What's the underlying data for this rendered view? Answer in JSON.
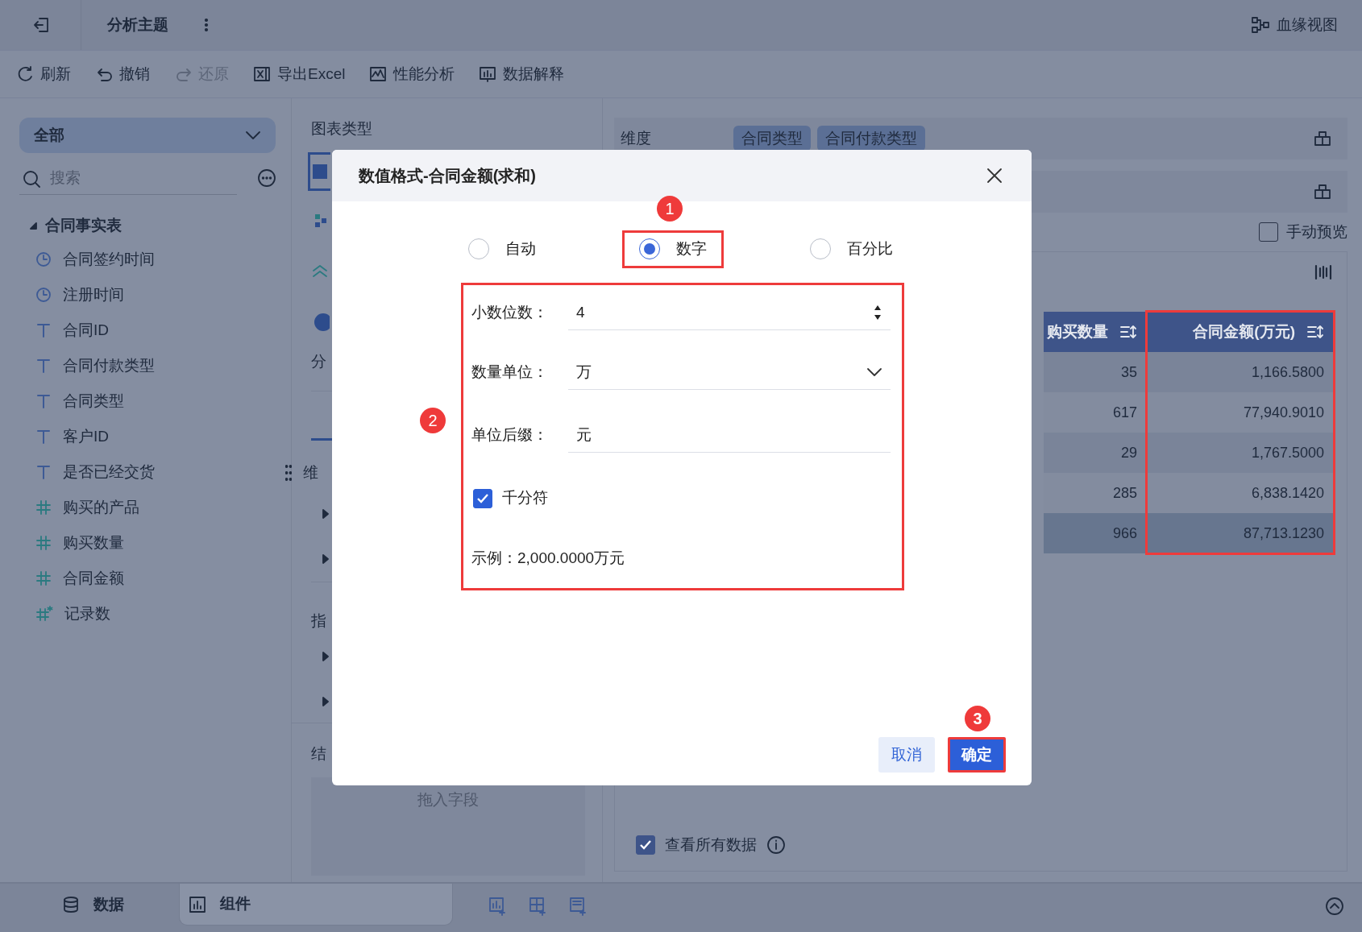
{
  "topbar": {
    "title": "分析主题",
    "lineage": "血缘视图"
  },
  "toolbar": [
    {
      "label": "刷新",
      "disabled": false
    },
    {
      "label": "撤销",
      "disabled": false
    },
    {
      "label": "还原",
      "disabled": true
    },
    {
      "label": "导出Excel",
      "disabled": false
    },
    {
      "label": "性能分析",
      "disabled": false
    },
    {
      "label": "数据解释",
      "disabled": false
    }
  ],
  "sidebar": {
    "scope": "全部",
    "search": {
      "placeholder": "搜索"
    },
    "table": {
      "label": "合同事实表",
      "expanded": true,
      "children": [
        {
          "kind": "date",
          "label": "合同签约时间"
        },
        {
          "kind": "date",
          "label": "注册时间"
        },
        {
          "kind": "text",
          "label": "合同ID"
        },
        {
          "kind": "text",
          "label": "合同付款类型"
        },
        {
          "kind": "text",
          "label": "合同类型"
        },
        {
          "kind": "text",
          "label": "客户ID"
        },
        {
          "kind": "text",
          "label": "是否已经交货"
        },
        {
          "kind": "number",
          "label": "购买的产品"
        },
        {
          "kind": "number",
          "label": "购买数量"
        },
        {
          "kind": "number",
          "label": "合同金额"
        },
        {
          "kind": "count",
          "label": "记录数"
        }
      ]
    }
  },
  "middle": {
    "heading": "图表类型",
    "chart_types": [
      {
        "selected": true
      },
      {
        "selected": false
      },
      {
        "selected": false
      },
      {
        "selected": false
      }
    ],
    "cut_labels": [
      "分",
      "维",
      "指",
      "结"
    ],
    "drop_hint": "拖入字段"
  },
  "right": {
    "dimension_label": "维度",
    "chips": [
      "合同类型",
      "合同付款类型"
    ],
    "manual_preview": {
      "label": "手动预览",
      "checked": false
    },
    "columns": [
      {
        "label": "购买数量",
        "highlighted": false,
        "cells": [
          "35",
          "617",
          "29",
          "285"
        ],
        "total": "966"
      },
      {
        "label": "合同金额(万元)",
        "highlighted": true,
        "cells": [
          "1,166.5800",
          "77,940.9010",
          "1,767.5000",
          "6,838.1420"
        ],
        "total": "87,713.1230"
      }
    ],
    "view_all": {
      "label": "查看所有数据",
      "checked": true
    }
  },
  "bottombar": {
    "tabs": [
      {
        "label": "数据",
        "selected": false
      },
      {
        "label": "组件",
        "selected": true
      }
    ]
  },
  "dialog": {
    "title": "数值格式-合同金额(求和)",
    "formats": [
      {
        "label": "自动",
        "selected": false,
        "highlighted": false
      },
      {
        "label": "数字",
        "selected": true,
        "highlighted": true,
        "callout": "1"
      },
      {
        "label": "百分比",
        "selected": false,
        "highlighted": false
      }
    ],
    "form": {
      "highlighted": true,
      "callout": "2",
      "decimals": {
        "label": "小数位数：",
        "value": "4"
      },
      "unit": {
        "label": "数量单位：",
        "value": "万"
      },
      "suffix": {
        "label": "单位后缀：",
        "value": "元"
      },
      "thousands": {
        "label": "千分符",
        "checked": true
      },
      "example": "示例：2,000.0000万元"
    },
    "cancel": "取消",
    "confirm": {
      "label": "确定",
      "highlighted": true,
      "callout": "3"
    }
  }
}
